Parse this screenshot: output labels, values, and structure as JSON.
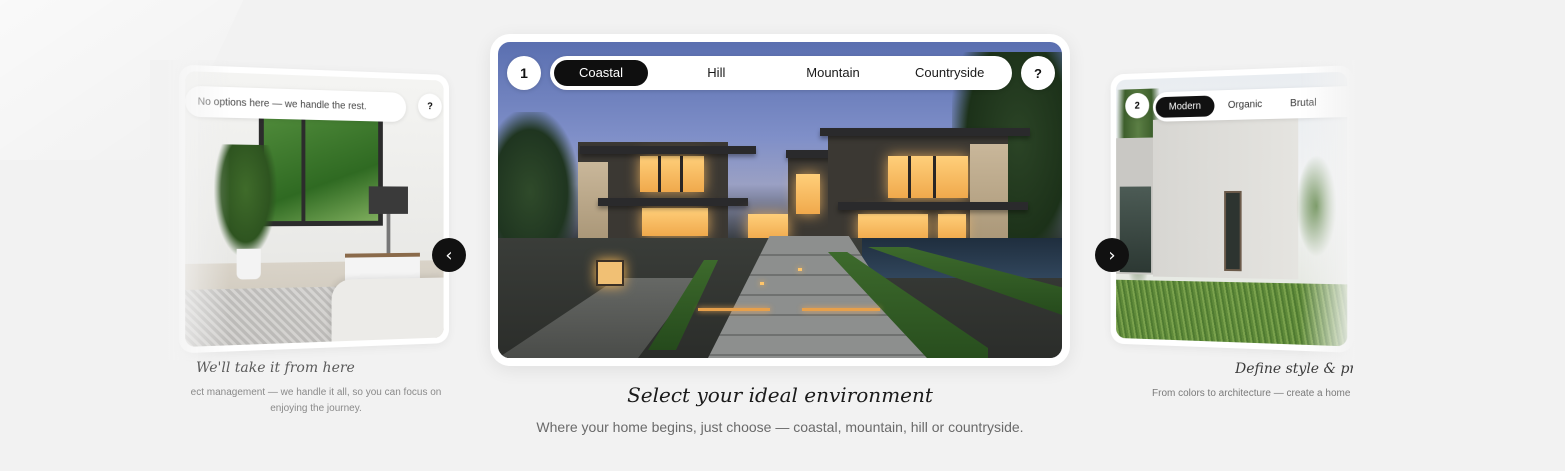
{
  "carousel": {
    "current": {
      "step": "1",
      "options": [
        "Coastal",
        "Hill",
        "Mountain",
        "Countryside"
      ],
      "selected": "Coastal",
      "help": "?",
      "title": "Select your ideal environment",
      "subtitle": "Where your home begins, just choose — coastal, mountain, hill or countryside."
    },
    "previous": {
      "bar_text": "No options here — we handle the rest.",
      "help": "?",
      "title": "We'll take it from here",
      "subtitle_line1": "ect management — we handle it all, so you can focus on",
      "subtitle_line2": "enjoying the journey."
    },
    "next": {
      "step": "2",
      "options": [
        "Modern",
        "Organic",
        "Brutal"
      ],
      "selected": "Modern",
      "title": "Define style & priorities",
      "subtitle": "From colors to architecture — create a home that"
    },
    "prev_arrow": "‹",
    "next_arrow": "›"
  },
  "colors": {
    "background": "#f2f2f2",
    "active_pill": "#0f0f0f",
    "arrow_button": "#111111"
  }
}
